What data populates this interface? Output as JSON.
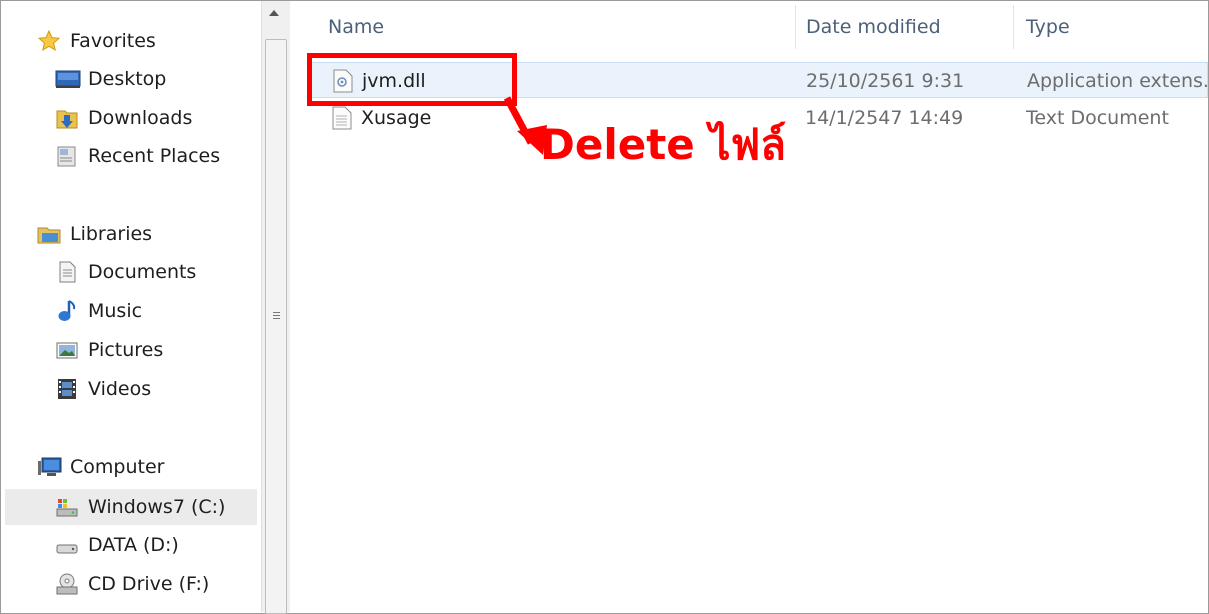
{
  "navigation": {
    "favorites": {
      "label": "Favorites",
      "icon": "star-icon"
    },
    "favorite_items": [
      {
        "label": "Desktop",
        "icon": "desktop-icon"
      },
      {
        "label": "Downloads",
        "icon": "downloads-icon"
      },
      {
        "label": "Recent Places",
        "icon": "recent-places-icon"
      }
    ],
    "libraries": {
      "label": "Libraries",
      "icon": "libraries-icon"
    },
    "library_items": [
      {
        "label": "Documents",
        "icon": "documents-icon"
      },
      {
        "label": "Music",
        "icon": "music-icon"
      },
      {
        "label": "Pictures",
        "icon": "pictures-icon"
      },
      {
        "label": "Videos",
        "icon": "videos-icon"
      }
    ],
    "computer": {
      "label": "Computer",
      "icon": "computer-icon"
    },
    "drives": [
      {
        "label": "Windows7 (C:)",
        "icon": "system-drive-icon",
        "selected": true
      },
      {
        "label": "DATA (D:)",
        "icon": "hard-drive-icon"
      },
      {
        "label": "CD Drive (F:)",
        "icon": "cd-drive-icon"
      }
    ]
  },
  "file_list": {
    "columns": {
      "name": "Name",
      "date": "Date modified",
      "type": "Type"
    },
    "rows": [
      {
        "name": "jvm.dll",
        "date": "25/10/2561 9:31",
        "type": "Application extens.",
        "icon": "dll-file-icon"
      },
      {
        "name": "Xusage",
        "date": "14/1/2547 14:49",
        "type": "Text Document",
        "icon": "text-file-icon"
      }
    ]
  },
  "annotation": {
    "text": "Delete ไฟล์",
    "color": "#ff0000"
  },
  "colors": {
    "header_text": "#4c607a",
    "selection": "#ebebeb",
    "hover_row": "#eaf3fb",
    "accent": "#ff0000"
  }
}
